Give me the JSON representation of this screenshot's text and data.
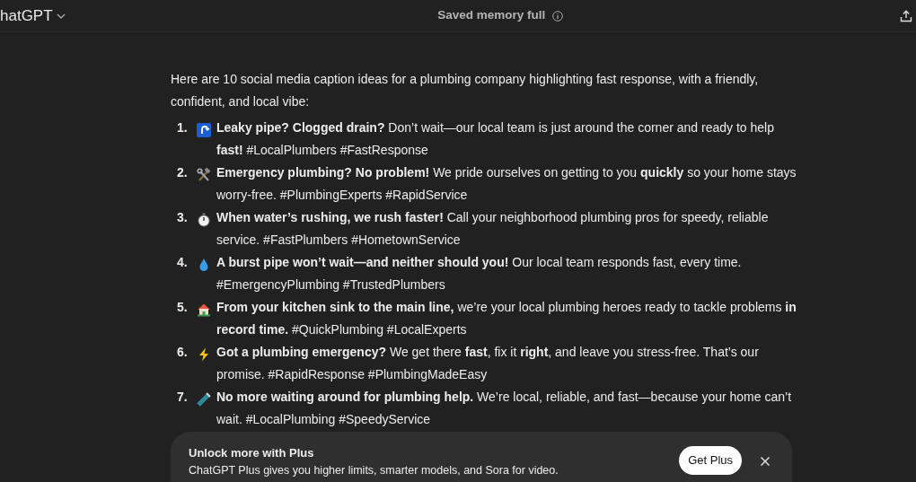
{
  "header": {
    "app_name": "hatGPT",
    "status": "Saved memory full"
  },
  "message": {
    "intro": "Here are 10 social media caption ideas for a plumbing company highlighting fast response, with a friendly, confident, and local vibe:",
    "items": [
      {
        "number": "1.",
        "kind": "arrow",
        "text": "**Leaky pipe? Clogged drain?** Don’t wait—our local team is just around the corner and ready to help **fast!** #LocalPlumbers #FastResponse"
      },
      {
        "number": "2.",
        "kind": "tools",
        "text": "**Emergency plumbing? No problem!** We pride ourselves on getting to you **quickly** so your home stays worry-free. #PlumbingExperts #RapidService"
      },
      {
        "number": "3.",
        "kind": "stopwatch",
        "text": "**When water’s rushing, we rush faster!** Call your neighborhood plumbing pros for speedy, reliable service. #FastPlumbers #HometownService"
      },
      {
        "number": "4.",
        "kind": "droplet",
        "text": "**A burst pipe won’t wait—and neither should you!** Our local team responds fast, every time. #EmergencyPlumbing #TrustedPlumbers"
      },
      {
        "number": "5.",
        "kind": "house",
        "text": "**From your kitchen sink to the main line,** we’re your local plumbing heroes ready to tackle problems **in record time.** #QuickPlumbing #LocalExperts"
      },
      {
        "number": "6.",
        "kind": "lightning",
        "text": "**Got a plumbing emergency?** We get there **fast**, fix it **right**, and leave you stress-free. That’s our promise. #RapidResponse #PlumbingMadeEasy"
      },
      {
        "number": "7.",
        "kind": "pipe",
        "text": "**No more waiting around for plumbing help.** We’re local, reliable, and fast—because your home can’t wait. #LocalPlumbing #SpeedyService"
      }
    ]
  },
  "banner": {
    "title": "Unlock more with Plus",
    "text": "ChatGPT Plus gives you higher limits, smarter models, and Sora for video.",
    "button": "Get Plus"
  }
}
